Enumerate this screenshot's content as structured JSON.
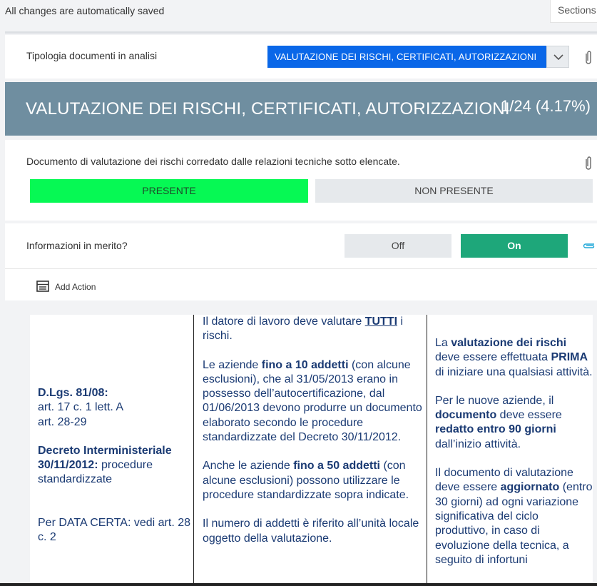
{
  "topbar": {
    "saved_text": "All changes are automatically saved",
    "sections_label": "Sections"
  },
  "doc_type": {
    "label": "Tipologia documenti in analisi",
    "selected": "VALUTAZIONE DEI RISCHI, CERTIFICATI, AUTORIZZAZIONI"
  },
  "banner": {
    "title": "VALUTAZIONE DEI RISCHI, CERTIFICATI, AUTORIZZAZIONI",
    "count": "1/24 (4.17%)"
  },
  "question1": {
    "text": "Documento di valutazione dei rischi corredato dalle relazioni tecniche sotto elencate.",
    "present_label": "PRESENTE",
    "not_present_label": "NON PRESENTE"
  },
  "question2": {
    "text": "Informazioni in merito?",
    "off_label": "Off",
    "on_label": "On"
  },
  "actions": {
    "add_action_label": "Add Action"
  },
  "colors": {
    "select_bg": "#0a67e8",
    "banner_bg": "#6f8ea0",
    "present_bg": "#06f954",
    "on_bg": "#1ea77a",
    "doc_text": "#1a3a73"
  },
  "doc": {
    "col1": {
      "law": "D.Lgs. 81/08:",
      "law_art1": "art. 17 c. 1 lett. A",
      "law_art2": "art. 28-29",
      "decree": "Decreto Interministeriale 30/11/2012:",
      "decree_rest": " procedure standardizzate",
      "certa": "Per DATA CERTA: vedi art. 28 c. 2"
    },
    "col2": {
      "p1_a": "Il datore di lavoro deve valutare ",
      "p1_b": "TUTTI",
      "p1_c": " i rischi.",
      "p2_a": "Le aziende ",
      "p2_b": "fino a 10 addetti",
      "p2_c": " (con alcune esclusioni), che al 31/05/2013 erano in possesso dell’autocertificazione, dal 01/06/2013 devono produrre un documento elaborato secondo le procedure standardizzate del Decreto 30/11/2012.",
      "p3_a": "Anche le aziende ",
      "p3_b": "fino a 50 addetti",
      "p3_c": " (con alcune esclusioni) possono utilizzare le procedure standardizzate sopra indicate.",
      "p4": "Il numero di addetti è riferito all’unità locale oggetto della valutazione."
    },
    "col3": {
      "p1_a": "La ",
      "p1_b": "valutazione dei rischi",
      "p1_c": " deve essere effettuata ",
      "p1_d": "PRIMA",
      "p1_e": " di iniziare una qualsiasi attività.",
      "p2_a": "Per le nuove aziende, il ",
      "p2_b": "documento",
      "p2_c": " deve essere ",
      "p2_d": "redatto entro 90 giorni",
      "p2_e": " dall’inizio attività.",
      "p3_a": "Il documento di valutazione deve essere ",
      "p3_b": "aggiornato",
      "p3_c": " (entro 30 giorni) ad ogni variazione significativa del ciclo produttivo, in caso di evoluzione della tecnica, a seguito di infortuni"
    }
  }
}
